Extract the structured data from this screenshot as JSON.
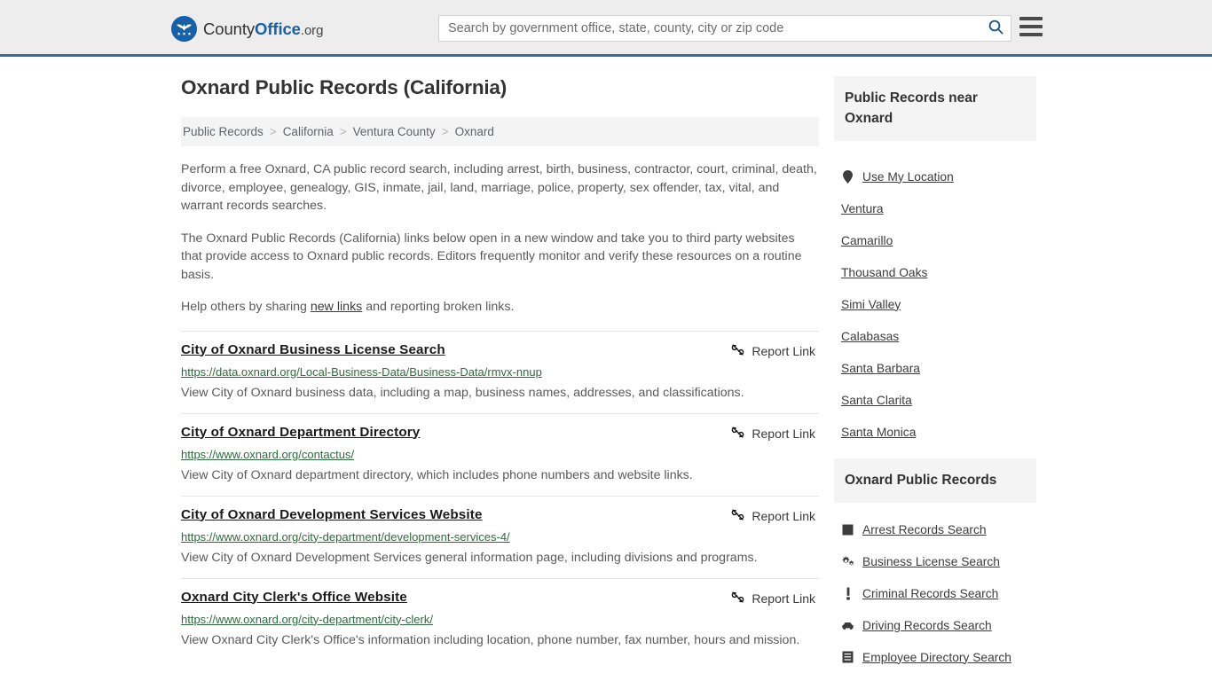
{
  "header": {
    "logo": {
      "icon": "eagle-shield-icon",
      "text_part1": "County",
      "text_part2": "Office",
      "text_part3": ".org"
    },
    "search": {
      "placeholder": "Search by government office, state, county, city or zip code",
      "value": "",
      "search_icon": "search-icon"
    },
    "menu_icon": "hamburger-menu-icon",
    "accent_color": "#31709e",
    "background_color": "#ededed"
  },
  "main": {
    "title": "Oxnard Public Records (California)",
    "breadcrumb": {
      "separator": ">",
      "items": [
        {
          "label": "Public Records"
        },
        {
          "label": "California"
        },
        {
          "label": "Ventura County"
        },
        {
          "label": "Oxnard"
        }
      ]
    },
    "paragraphs": {
      "p1": "Perform a free Oxnard, CA public record search, including arrest, birth, business, contractor, court, criminal, death, divorce, employee, genealogy, GIS, inmate, jail, land, marriage, police, property, sex offender, tax, vital, and warrant records searches.",
      "p2": "The Oxnard Public Records (California) links below open in a new window and take you to third party websites that provide access to Oxnard public records. Editors frequently monitor and verify these resources on a routine basis.",
      "p3_before": "Help others by sharing ",
      "p3_link": "new links",
      "p3_after": " and reporting broken links."
    },
    "report_link_label": "Report Link",
    "report_link_icon": "broken-chain-icon",
    "results": [
      {
        "title": "City of Oxnard Business License Search",
        "url": "https://data.oxnard.org/Local-Business-Data/Business-Data/rmvx-nnup",
        "description": "View City of Oxnard business data, including a map, business names, addresses, and classifications."
      },
      {
        "title": "City of Oxnard Department Directory",
        "url": "https://www.oxnard.org/contactus/",
        "description": "View City of Oxnard department directory, which includes phone numbers and website links."
      },
      {
        "title": "City of Oxnard Development Services Website",
        "url": "https://www.oxnard.org/city-department/development-services-4/",
        "description": "View City of Oxnard Development Services general information page, including divisions and programs."
      },
      {
        "title": "Oxnard City Clerk's Office Website",
        "url": "https://www.oxnard.org/city-department/city-clerk/",
        "description": "View Oxnard City Clerk's Office's information including location, phone number, fax number, hours and mission."
      }
    ]
  },
  "sidebar": {
    "nearby_panel": {
      "heading": "Public Records near Oxnard",
      "use_location": {
        "label": "Use My Location",
        "icon": "map-pin-icon"
      },
      "cities": [
        {
          "label": "Ventura"
        },
        {
          "label": "Camarillo"
        },
        {
          "label": "Thousand Oaks"
        },
        {
          "label": "Simi Valley"
        },
        {
          "label": "Calabasas"
        },
        {
          "label": "Santa Barbara"
        },
        {
          "label": "Santa Clarita"
        },
        {
          "label": "Santa Monica"
        }
      ]
    },
    "records_panel": {
      "heading": "Oxnard Public Records",
      "items": [
        {
          "label": "Arrest Records Search",
          "icon": "fingerprint-icon"
        },
        {
          "label": "Business License Search",
          "icon": "cogs-icon"
        },
        {
          "label": "Criminal Records Search",
          "icon": "exclamation-icon"
        },
        {
          "label": "Driving Records Search",
          "icon": "car-icon"
        },
        {
          "label": "Employee Directory Search",
          "icon": "book-icon"
        }
      ]
    }
  },
  "colors": {
    "link_green": "#2e6b3e",
    "panel_gray": "#f4f4f4",
    "brand_blue": "#1761a8"
  }
}
